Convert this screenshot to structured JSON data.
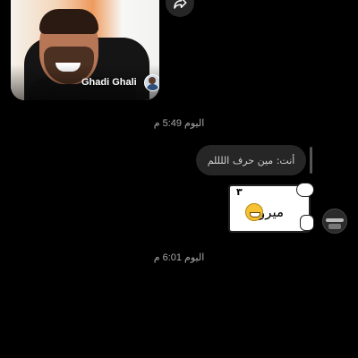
{
  "shared_post": {
    "username": "Ghadi Ghali"
  },
  "messages": [
    {
      "timestamp": "اليوم 5:49 م"
    },
    {
      "reply_text": "أنت: مين حرف اللللم"
    },
    {
      "sticker_text": "ميرو",
      "sticker_corner": "٣"
    },
    {
      "timestamp": "اليوم 6:01 م"
    }
  ],
  "icons": {
    "share": "share-arrow-icon",
    "avatar": "user-avatar"
  }
}
